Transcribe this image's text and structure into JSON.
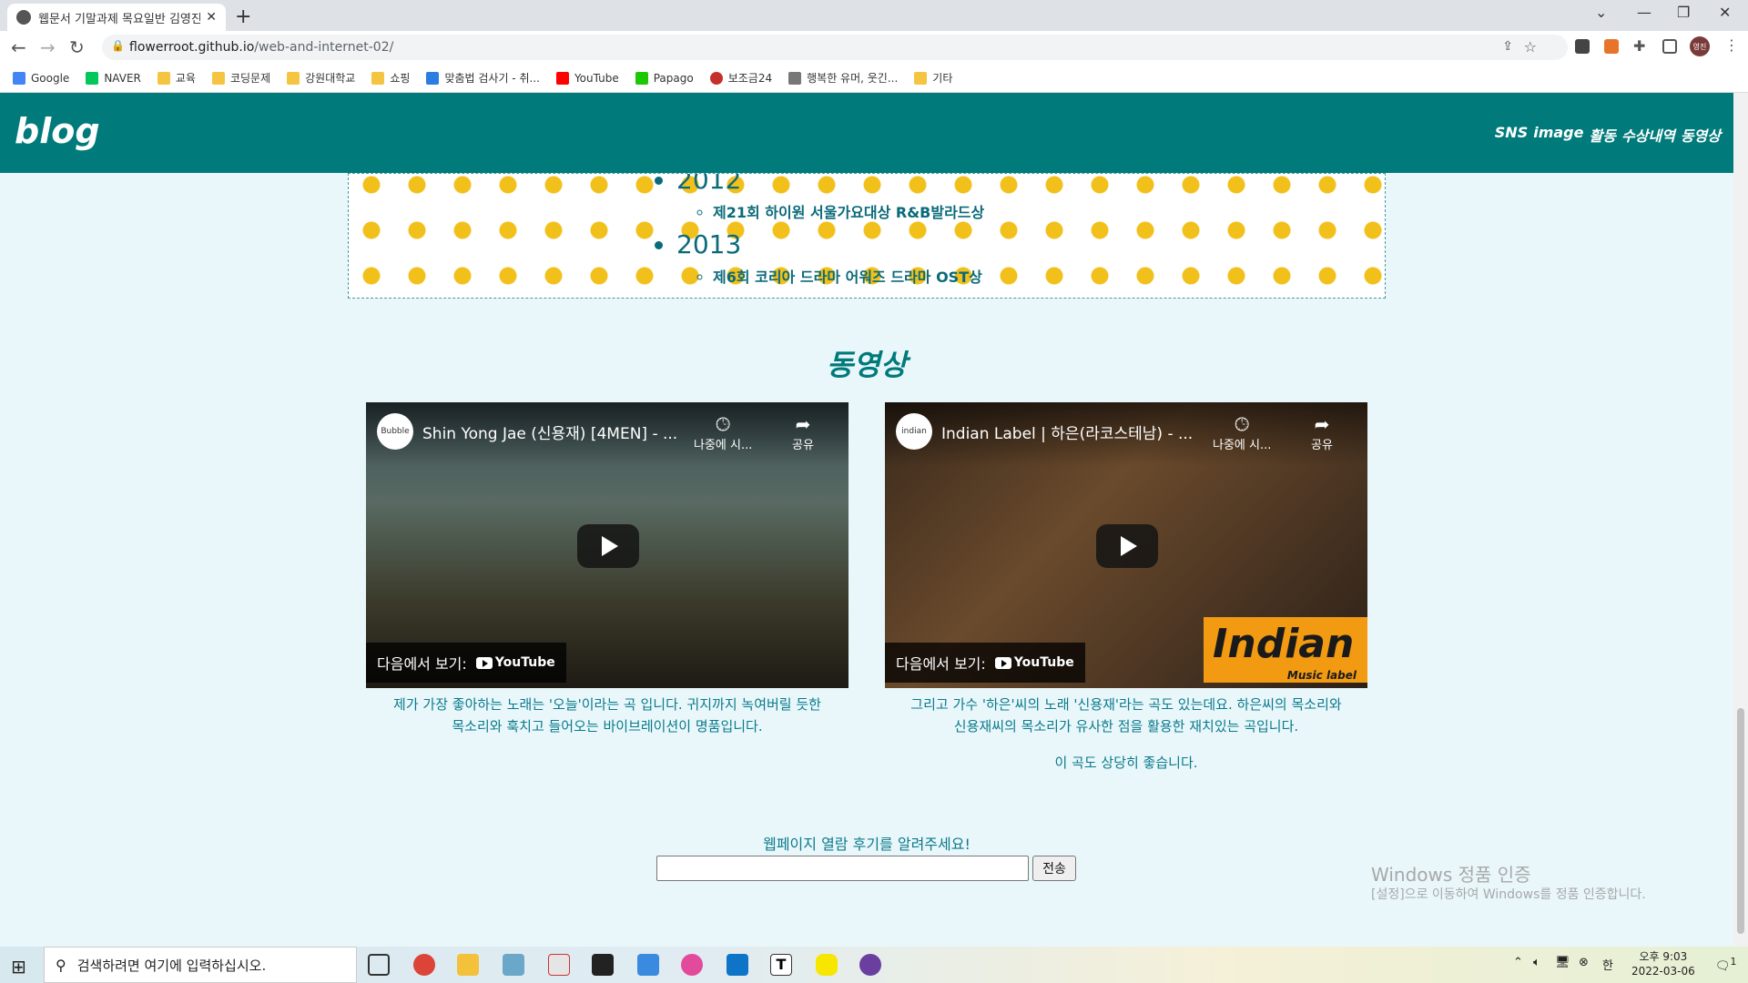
{
  "browser": {
    "tab_title": "웹문서 기말과제 목요일반 김영진",
    "url_host": "flowerroot.github.io",
    "url_path": "/web-and-internet-02/",
    "profile_initial": "영진"
  },
  "bookmarks": [
    "Google",
    "NAVER",
    "교육",
    "코딩문제",
    "강원대학교",
    "쇼핑",
    "맞춤법 검사기 - 취...",
    "YouTube",
    "Papago",
    "보조금24",
    "행복한 유머, 웃긴...",
    "기타"
  ],
  "site": {
    "logo": "blog",
    "menu": [
      "SNS",
      "image",
      "활동",
      "수상내역",
      "동영상"
    ]
  },
  "awards": [
    {
      "year": "2012",
      "item": "제21회 하이원 서울가요대상 R&B발라드상"
    },
    {
      "year": "2013",
      "item": "제6회 코리아 드라마 어워즈 드라마 OST상"
    }
  ],
  "videos_section": {
    "title": "동영상",
    "watch_on": "다음에서 보기:",
    "youtube": "YouTube",
    "watch_later": "나중에 시...",
    "share": "공유",
    "videos": [
      {
        "channel_badge": "Bubble",
        "title": "Shin Yong Jae (신용재) [4MEN] - ...",
        "caption_lines": [
          "제가 가장 좋아하는 노래는 '오늘'이라는 곡 입니다. 귀지까지 녹여버릴 듯한",
          "목소리와 훅치고 들어오는 바이브레이션이 명품입니다."
        ]
      },
      {
        "channel_badge": "indian",
        "title": "Indian Label | 하은(라코스테남) - ...",
        "overlay_logo": "Indian",
        "overlay_sub": "Music label",
        "caption_lines": [
          "그리고 가수 '하은'씨의 노래 '신용재'라는 곡도 있는데요. 하은씨의 목소리와",
          "신용재씨의 목소리가 유사한 점을 활용한 재치있는 곡입니다.",
          "이 곡도 상당히 좋습니다."
        ]
      }
    ]
  },
  "feedback": {
    "label": "웹페이지 열람 후기를 알려주세요!",
    "input_value": "",
    "submit": "전송"
  },
  "watermark": {
    "line1": "Windows 정품 인증",
    "line2": "[설정]으로 이동하여 Windows를 정품 인증합니다."
  },
  "taskbar": {
    "search_placeholder": "검색하려면 여기에 입력하십시오.",
    "ime": "한",
    "time": "오후 9:03",
    "date": "2022-03-06",
    "notifications": "1"
  }
}
